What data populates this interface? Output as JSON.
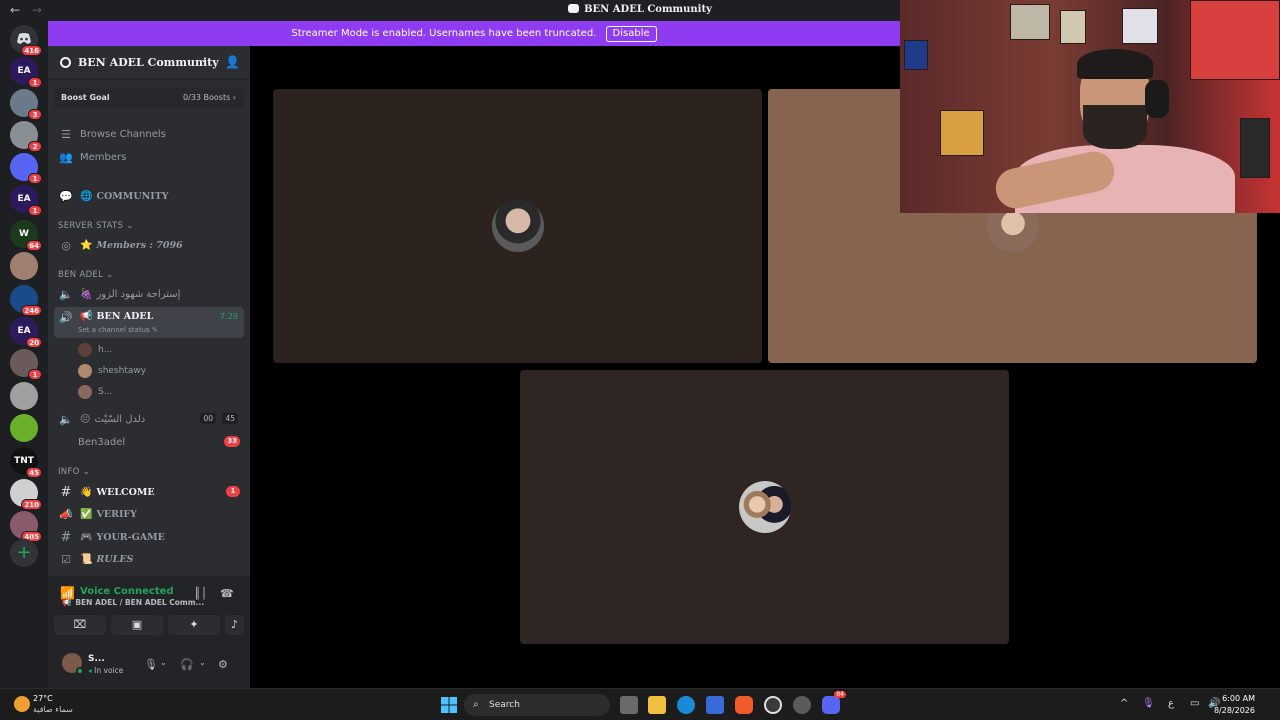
{
  "window": {
    "title": "BEN ADEL Community",
    "back_arrow": "←",
    "forward_arrow": "→"
  },
  "streamer_banner": {
    "text": "Streamer Mode is enabled. Usernames have been truncated.",
    "button": "Disable"
  },
  "guild_rail": {
    "home_badge": "416",
    "items": [
      {
        "label": "EA",
        "badge": "1",
        "color": "#2d1a5c"
      },
      {
        "label": "",
        "badge": "3",
        "color": "#6a7a8a"
      },
      {
        "label": "",
        "badge": "2",
        "color": "#8a8f96"
      },
      {
        "label": "",
        "badge": "1",
        "color": "#5865f2"
      },
      {
        "label": "EA",
        "badge": "1",
        "color": "#2d1a5c"
      },
      {
        "label": "W",
        "badge": "64",
        "color": "#1a3a1a"
      },
      {
        "label": "",
        "badge": "",
        "color": "#a08070"
      },
      {
        "label": "",
        "badge": "246",
        "color": "#1a4a8a"
      },
      {
        "label": "EA",
        "badge": "20",
        "color": "#2d1a5c"
      },
      {
        "label": "",
        "badge": "1",
        "color": "#6a5a5a"
      },
      {
        "label": "",
        "badge": "",
        "color": "#a0a0a0"
      },
      {
        "label": "",
        "badge": "",
        "color": "#6ab02a"
      },
      {
        "label": "TNT",
        "badge": "45",
        "color": "#111111"
      },
      {
        "label": "",
        "badge": "210",
        "color": "#d0d0d0"
      },
      {
        "label": "",
        "badge": "405",
        "color": "#8a5a6a"
      }
    ]
  },
  "server": {
    "name": "BEN ADEL Community",
    "boost_goal_label": "Boost Goal",
    "boost_goal_value": "0/33 Boosts ›",
    "browse_channels": "Browse Channels",
    "members": "Members",
    "community_channel": "COMMUNITY",
    "categories": {
      "server_stats": "SERVER STATS",
      "ben_adel": "BEN ADEL",
      "info": "INFO"
    },
    "members_stat": "Members : 7096",
    "arabic_channel_1": "إستراحة شهود الزور",
    "voice_channel": {
      "name": "BEN ADEL",
      "timer": "7:29",
      "status_hint": "Set a channel status"
    },
    "voice_members": [
      "h...",
      "sheshtawy",
      "S..."
    ],
    "arabic_channel_2": "دلدل السّيْث",
    "arabic_channel_2_counts": [
      "00",
      "45"
    ],
    "ben3adel": "Ben3adel",
    "ben3adel_badge": "33",
    "info_channels": [
      {
        "name": "WELCOME",
        "badge": "1"
      },
      {
        "name": "VERIFY",
        "badge": ""
      },
      {
        "name": "YOUR-GAME",
        "badge": ""
      },
      {
        "name": "RULES",
        "badge": ""
      }
    ]
  },
  "voice_panel": {
    "status": "Voice Connected",
    "location": "BEN ADEL / BEN ADEL Comm..."
  },
  "user_panel": {
    "name": "S...",
    "status": "In voice"
  },
  "taskbar": {
    "temperature": "27°C",
    "weather": "سماء صافية",
    "search": "Search",
    "discord_badge": "94",
    "lang": "ع",
    "time": "6:00 AM",
    "date": "8/28/2026"
  },
  "colors": {
    "accent_purple": "#8f3bf1",
    "connected_green": "#23a559",
    "badge_red": "#f23f43",
    "tile_dark": "#2c221e",
    "tile_tan": "#876450",
    "tile_bottom": "#2f2624"
  }
}
